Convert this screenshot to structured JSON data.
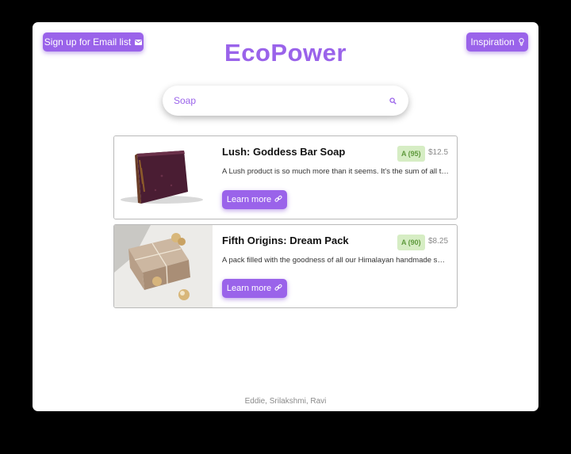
{
  "header": {
    "email_button": "Sign up for Email list",
    "email_icon": "envelope-icon",
    "brand": "EcoPower",
    "inspiration_button": "Inspiration",
    "inspiration_icon": "lightbulb-icon"
  },
  "search": {
    "value": "Soap",
    "placeholder": "Soap",
    "icon": "search-icon"
  },
  "products": [
    {
      "title": "Lush: Goddess Bar Soap",
      "grade": "A (95)",
      "price": "$12.5",
      "description": "A Lush product is so much more than it seems. It's the sum of all the ethical",
      "button": "Learn more",
      "button_icon": "link-icon",
      "image": "purple-bar-soap"
    },
    {
      "title": "Fifth Origins: Dream Pack",
      "grade": "A (90)",
      "price": "$8.25",
      "description": "A pack filled with the goodness of all our Himalayan handmade soaps",
      "button": "Learn more",
      "button_icon": "link-icon",
      "image": "wrapped-soap-pack"
    }
  ],
  "colors": {
    "accent": "#9a63ea",
    "grade_bg": "#d6edc4",
    "grade_text": "#5f9a3d"
  },
  "footer": {
    "credits": "Eddie, Srilakshmi, Ravi"
  }
}
